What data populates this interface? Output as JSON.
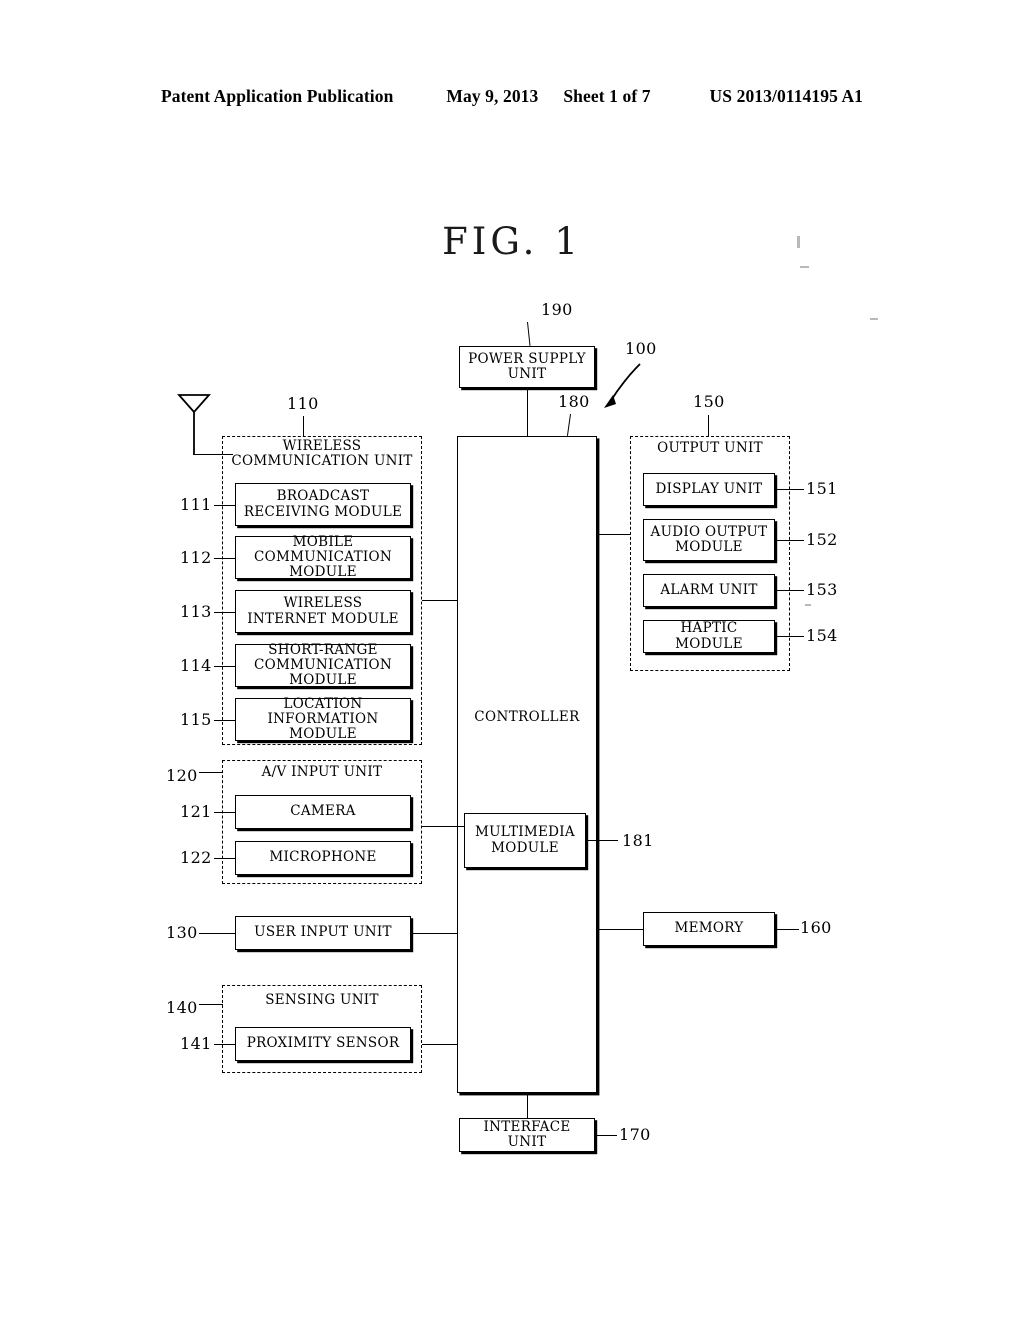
{
  "header": {
    "publication": "Patent Application Publication",
    "date": "May 9, 2013",
    "sheet": "Sheet 1 of 7",
    "patent_number": "US 2013/0114195 A1"
  },
  "figure": {
    "label": "FIG.",
    "number": "1",
    "system_ref": "100"
  },
  "blocks": {
    "power_supply": {
      "label": "POWER SUPPLY\nUNIT",
      "ref": "190"
    },
    "controller": {
      "label": "CONTROLLER",
      "ref": "180"
    },
    "multimedia_module": {
      "label": "MULTIMEDIA\nMODULE",
      "ref": "181"
    },
    "memory": {
      "label": "MEMORY",
      "ref": "160"
    },
    "interface_unit": {
      "label": "INTERFACE UNIT",
      "ref": "170"
    },
    "user_input_unit": {
      "label": "USER INPUT UNIT",
      "ref": "130"
    }
  },
  "wireless_communication_unit": {
    "title": "WIRELESS\nCOMMUNICATION UNIT",
    "ref": "110",
    "modules": [
      {
        "label": "BROADCAST\nRECEIVING MODULE",
        "ref": "111"
      },
      {
        "label": "MOBILE\nCOMMUNICATION MODULE",
        "ref": "112"
      },
      {
        "label": "WIRELESS\nINTERNET MODULE",
        "ref": "113"
      },
      {
        "label": "SHORT-RANGE\nCOMMUNICATION MODULE",
        "ref": "114"
      },
      {
        "label": "LOCATION\nINFORMATION MODULE",
        "ref": "115"
      }
    ]
  },
  "av_input_unit": {
    "title": "A/V  INPUT UNIT",
    "ref": "120",
    "modules": [
      {
        "label": "CAMERA",
        "ref": "121"
      },
      {
        "label": "MICROPHONE",
        "ref": "122"
      }
    ]
  },
  "sensing_unit": {
    "title": "SENSING UNIT",
    "ref": "140",
    "modules": [
      {
        "label": "PROXIMITY SENSOR",
        "ref": "141"
      }
    ]
  },
  "output_unit": {
    "title": "OUTPUT UNIT",
    "ref": "150",
    "modules": [
      {
        "label": "DISPLAY UNIT",
        "ref": "151"
      },
      {
        "label": "AUDIO OUTPUT\nMODULE",
        "ref": "152"
      },
      {
        "label": "ALARM UNIT",
        "ref": "153"
      },
      {
        "label": "HAPTIC MODULE",
        "ref": "154"
      }
    ]
  },
  "icons": {
    "antenna": "antenna-icon"
  },
  "colors": {
    "ink": "#000000",
    "paper": "#ffffff"
  }
}
